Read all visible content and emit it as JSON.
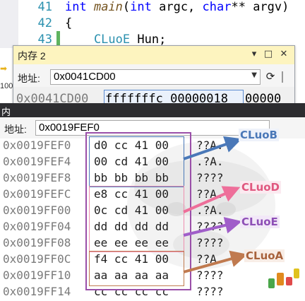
{
  "editor": {
    "lines": [
      {
        "number": "41",
        "tokens": [
          {
            "t": "int ",
            "c": "kw"
          },
          {
            "t": "main",
            "c": "fn"
          },
          {
            "t": "(",
            "c": ""
          },
          {
            "t": "int ",
            "c": "kw"
          },
          {
            "t": "argc, ",
            "c": ""
          },
          {
            "t": "char",
            "c": "kw"
          },
          {
            "t": "** argv)",
            "c": ""
          }
        ]
      },
      {
        "number": "42",
        "tokens": [
          {
            "t": "{",
            "c": ""
          }
        ]
      },
      {
        "number": "43",
        "tokens": [
          {
            "t": "    CLuoE ",
            "c": "ty"
          },
          {
            "t": "Hun;",
            "c": ""
          }
        ]
      }
    ]
  },
  "memory2": {
    "title": "内存 2",
    "address_label": "地址:",
    "address_value": "0x0041CD00",
    "row_address": "0x0041CD00",
    "row_values": "fffffffc 00000018",
    "row_more": "00000",
    "buttons": {
      "dropdown": "▾",
      "restore": "□",
      "close": "✕",
      "refresh": "⟳"
    }
  },
  "side": {
    "zoom": "100",
    "arrow": "➡"
  },
  "memory1": {
    "header": "内",
    "address_label": "地址:",
    "address_value": "0x0019FEF0",
    "rows": [
      {
        "addr": "0x0019FEF0",
        "bytes": "d0 cc 41 00",
        "ascii": "??A."
      },
      {
        "addr": "0x0019FEF4",
        "bytes": "00 cd 41 00",
        "ascii": ".?A."
      },
      {
        "addr": "0x0019FEF8",
        "bytes": "bb bb bb bb",
        "ascii": "????"
      },
      {
        "addr": "0x0019FEFC",
        "bytes": "e8 cc 41 00",
        "ascii": "??A."
      },
      {
        "addr": "0x0019FF00",
        "bytes": "0c cd 41 00",
        "ascii": ".?A."
      },
      {
        "addr": "0x0019FF04",
        "bytes": "dd dd dd dd",
        "ascii": "????"
      },
      {
        "addr": "0x0019FF08",
        "bytes": "ee ee ee ee",
        "ascii": "????"
      },
      {
        "addr": "0x0019FF0C",
        "bytes": "f4 cc 41 00",
        "ascii": "??A."
      },
      {
        "addr": "0x0019FF10",
        "bytes": "aa aa aa aa",
        "ascii": "????"
      },
      {
        "addr": "0x0019FF14",
        "bytes": "cc cc cc cc",
        "ascii": "????"
      }
    ]
  },
  "annotations": [
    {
      "label": "CLuoB",
      "color": "#4a78b8"
    },
    {
      "label": "CLuoD",
      "color": "#ee6f9a"
    },
    {
      "label": "CLuoE",
      "color": "#a05ec9"
    },
    {
      "label": "CLuoA",
      "color": "#c07a4f"
    }
  ],
  "box_colors": {
    "outer": "#9a4fa8",
    "blue": "#4a78b8",
    "pink": "#ee8fb0",
    "brown": "#c07a4f"
  }
}
